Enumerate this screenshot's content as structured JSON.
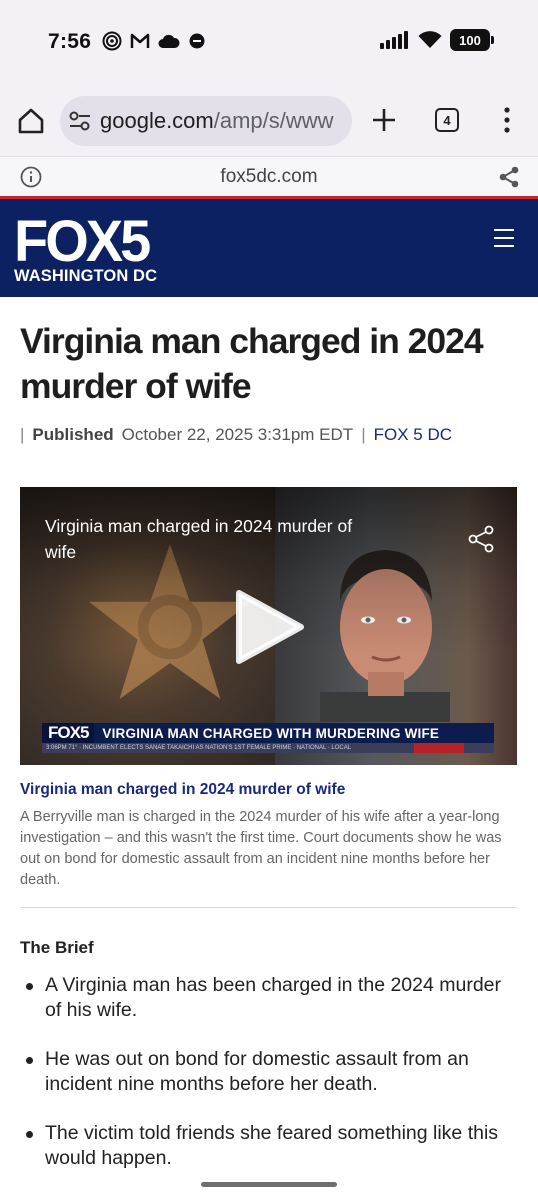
{
  "status_bar": {
    "time": "7:56",
    "battery": "100",
    "left_icons": [
      "fingerprint-icon",
      "gmail-icon",
      "cloud-icon",
      "app-icon"
    ],
    "right_icons": [
      "signal-icon",
      "wifi-icon",
      "battery-icon"
    ]
  },
  "browser": {
    "url_host": "google.com",
    "url_path": "/amp/s/www",
    "tab_count": "4",
    "site_domain": "fox5dc.com"
  },
  "site_header": {
    "logo_word": "FOX5",
    "logo_sub": "WASHINGTON DC",
    "brand_color": "#0b2161",
    "accent_color": "#c9252c"
  },
  "article": {
    "headline": "Virginia man charged in 2024 murder of wife",
    "byline": {
      "label": "Published",
      "date": "October 22, 2025 3:31pm EDT",
      "source": "FOX 5 DC"
    },
    "video": {
      "title": "Virginia man charged in 2024 murder of wife",
      "lower_third_logo": "FOX5",
      "lower_third_text": "VIRGINIA MAN CHARGED WITH MURDERING WIFE",
      "ticker_text": "3:06PM 71° · INCUMBENT ELECTS SANAE TAKAICHI AS NATION'S 1ST FEMALE PRIME · NATIONAL · LOCAL"
    },
    "caption_title": "Virginia man charged in 2024 murder of wife",
    "caption_body": "A Berryville man is charged in the 2024 murder of his wife after a year-long investigation – and this wasn't the first time. Court documents show he was out on bond for domestic assault from an incident nine months before her death.",
    "brief_heading": "The Brief",
    "brief_items": [
      "A Virginia man has been charged in the 2024 murder of his wife.",
      "He was out on bond for domestic assault from an incident nine months before her death.",
      "The victim told friends she feared something like this would happen."
    ]
  }
}
